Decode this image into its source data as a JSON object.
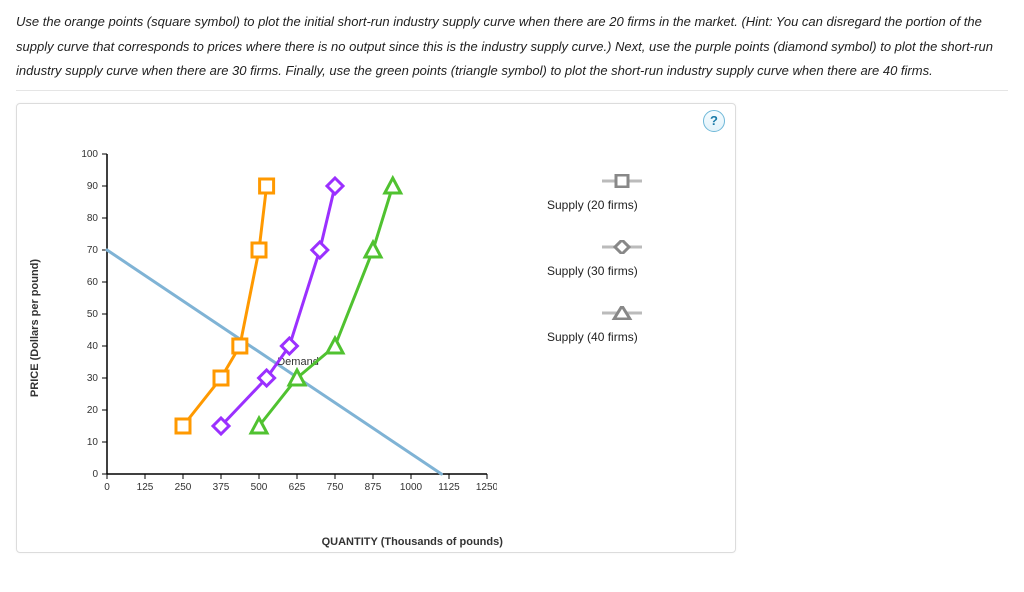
{
  "instructions": "Use the orange points (square symbol) to plot the initial short-run industry supply curve when there are 20 firms in the market. (Hint: You can disregard the portion of the supply curve that corresponds to prices where there is no output since this is the industry supply curve.) Next, use the purple points (diamond symbol) to plot the short-run industry supply curve when there are 30 firms. Finally, use the green points (triangle symbol) to plot the short-run industry supply curve when there are 40 firms.",
  "help_label": "?",
  "legend": {
    "supply20": "Supply (20 firms)",
    "supply30": "Supply (30 firms)",
    "supply40": "Supply (40 firms)"
  },
  "chart_data": {
    "type": "line",
    "xlabel": "QUANTITY (Thousands of pounds)",
    "ylabel": "PRICE (Dollars per pound)",
    "xlim": [
      0,
      1250
    ],
    "ylim": [
      0,
      100
    ],
    "x_ticks": [
      0,
      125,
      250,
      375,
      500,
      625,
      750,
      875,
      1000,
      1125,
      1250
    ],
    "y_ticks": [
      0,
      10,
      20,
      30,
      40,
      50,
      60,
      70,
      80,
      90,
      100
    ],
    "series": [
      {
        "name": "Demand",
        "color": "#7fb3d5",
        "marker": "none",
        "points": [
          {
            "x": 0,
            "y": 70
          },
          {
            "x": 1100,
            "y": 0
          }
        ],
        "label_at": {
          "x": 560,
          "y": 34
        }
      },
      {
        "name": "Supply (20 firms)",
        "color": "#ff9900",
        "marker": "square",
        "points": [
          {
            "x": 250,
            "y": 15
          },
          {
            "x": 375,
            "y": 30
          },
          {
            "x": 437,
            "y": 40
          },
          {
            "x": 500,
            "y": 70
          },
          {
            "x": 525,
            "y": 90
          }
        ]
      },
      {
        "name": "Supply (30 firms)",
        "color": "#9b30ff",
        "marker": "diamond",
        "points": [
          {
            "x": 375,
            "y": 15
          },
          {
            "x": 525,
            "y": 30
          },
          {
            "x": 600,
            "y": 40
          },
          {
            "x": 700,
            "y": 70
          },
          {
            "x": 750,
            "y": 90
          }
        ]
      },
      {
        "name": "Supply (40 firms)",
        "color": "#50c230",
        "marker": "triangle",
        "points": [
          {
            "x": 500,
            "y": 15
          },
          {
            "x": 625,
            "y": 30
          },
          {
            "x": 750,
            "y": 40
          },
          {
            "x": 875,
            "y": 70
          },
          {
            "x": 940,
            "y": 90
          }
        ]
      }
    ]
  }
}
